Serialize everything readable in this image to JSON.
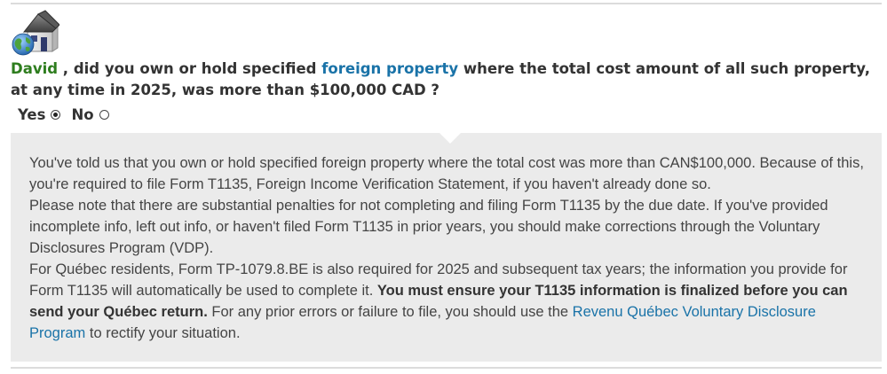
{
  "question": {
    "user_name": "David",
    "part1": " , did you own or hold specified ",
    "link": "foreign property",
    "part2": " where the total cost amount of all such property, at any time in 2025, was more than $100,000 CAD ?"
  },
  "options": {
    "yes_label": "Yes",
    "no_label": "No",
    "selected": "Yes"
  },
  "info": {
    "para1": "You've told us that you own or hold specified foreign property where the total cost was more than CAN$100,000. Because of this, you're required to file Form T1135, Foreign Income Verification Statement, if you haven't already done so.",
    "para2": "Please note that there are substantial penalties for not completing and filing Form T1135 by the due date. If you've provided incomplete info, left out info, or haven't filed Form T1135 in prior years, you should make corrections through the Voluntary Disclosures Program (VDP).",
    "para3_start": "For Québec residents, Form TP-1079.8.BE is also required for 2025 and subsequent tax years; the information you provide for Form T1135 will automatically be used to complete it. ",
    "para3_bold": "You must ensure your T1135 information is finalized before you can send your Québec return.",
    "para3_mid": " For any prior errors or failure to file, you should use the ",
    "para3_link": "Revenu Québec Voluntary Disclosure Program",
    "para3_end": " to rectify your situation."
  },
  "icons": {
    "house": "house-globe-icon"
  }
}
